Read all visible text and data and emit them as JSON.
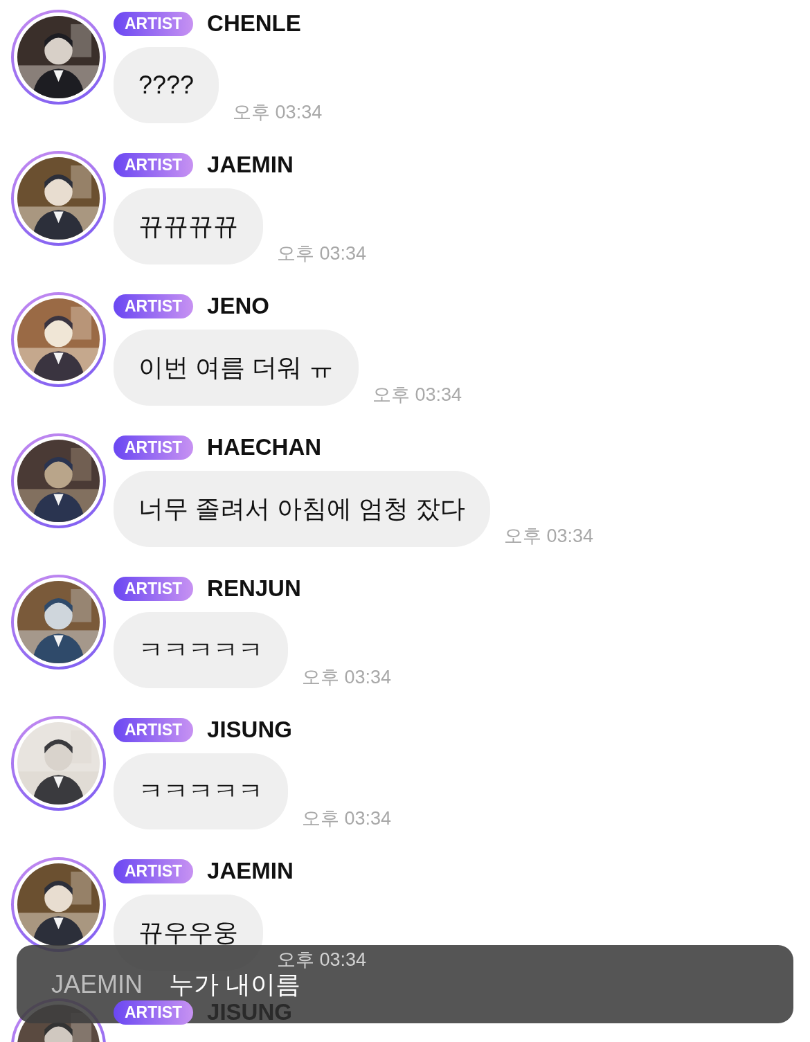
{
  "messages": [
    {
      "badge": "ARTIST",
      "name": "CHENLE",
      "text": "????",
      "time": "오후 03:34"
    },
    {
      "badge": "ARTIST",
      "name": "JAEMIN",
      "text": "뀨뀨뀨뀨",
      "time": "오후 03:34"
    },
    {
      "badge": "ARTIST",
      "name": "JENO",
      "text": "이번 여름 더워 ㅠ",
      "time": "오후 03:34"
    },
    {
      "badge": "ARTIST",
      "name": "HAECHAN",
      "text": "너무 졸려서 아침에 엄청 잤다",
      "time": "오후 03:34"
    },
    {
      "badge": "ARTIST",
      "name": "RENJUN",
      "text": "ㅋㅋㅋㅋㅋ",
      "time": "오후 03:34"
    },
    {
      "badge": "ARTIST",
      "name": "JISUNG",
      "text": "ㅋㅋㅋㅋㅋ",
      "time": "오후 03:34"
    },
    {
      "badge": "ARTIST",
      "name": "JAEMIN",
      "text": "뀨우우웅",
      "time": "오후 03:34"
    },
    {
      "badge": "ARTIST",
      "name": "JISUNG"
    }
  ],
  "toast": {
    "sender": "JAEMIN",
    "text": "누가 내이름"
  }
}
